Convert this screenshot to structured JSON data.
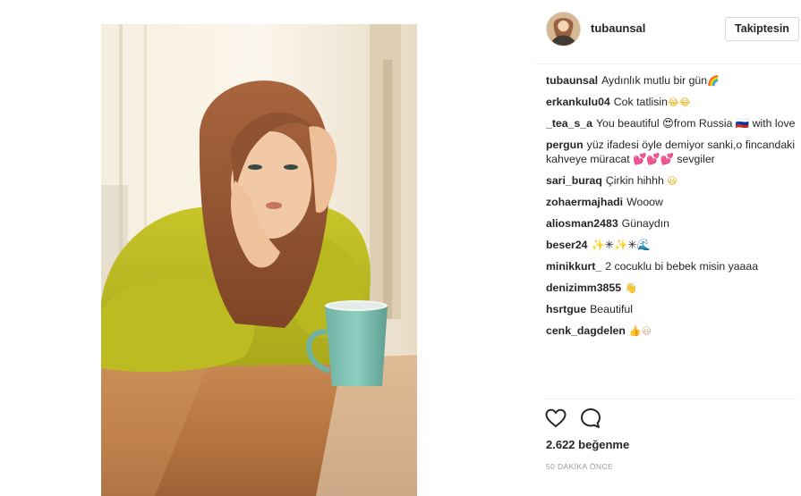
{
  "post": {
    "username": "tubaunsal",
    "follow_label": "Takiptesin",
    "likes_text": "2.622 beğenme",
    "timestamp": "50 DAKİKA ÖNCE"
  },
  "comments": [
    {
      "author": "tubaunsal",
      "text": "Aydınlık mutlu bir gün",
      "emoji": "🌈"
    },
    {
      "author": "erkankulu04",
      "text": "Cok tatlisin",
      "emoji": "😂😂"
    },
    {
      "author": "_tea_s_a",
      "text": "You beautiful 😍from Russia 🇷🇺 with love",
      "emoji": ""
    },
    {
      "author": "pergun",
      "text": "yüz ifadesi öyle demiyor sanki,o fincandaki kahveye müracat 💕💕💕 sevgiler",
      "emoji": ""
    },
    {
      "author": "sari_buraq",
      "text": "Çirkin hihhh",
      "emoji": "😃"
    },
    {
      "author": "zohaermajhadi",
      "text": "Wooow",
      "emoji": ""
    },
    {
      "author": "aliosman2483",
      "text": "Günaydın",
      "emoji": ""
    },
    {
      "author": "beser24",
      "text": "✨✳✨✳🌊",
      "emoji": ""
    },
    {
      "author": "minikkurt_",
      "text": "2 cocuklu bi bebek misin yaaaa",
      "emoji": ""
    },
    {
      "author": "denizimm3855",
      "text": "",
      "emoji": "👋"
    },
    {
      "author": "hsrtgue",
      "text": "Beautiful",
      "emoji": ""
    },
    {
      "author": "cenk_dagdelen",
      "text": "",
      "emoji": "👍😃"
    }
  ],
  "icons": {
    "like": "heart-icon",
    "comment": "comment-icon"
  },
  "colors": {
    "text": "#262626",
    "muted": "#999999",
    "border": "#dbdbdb"
  }
}
